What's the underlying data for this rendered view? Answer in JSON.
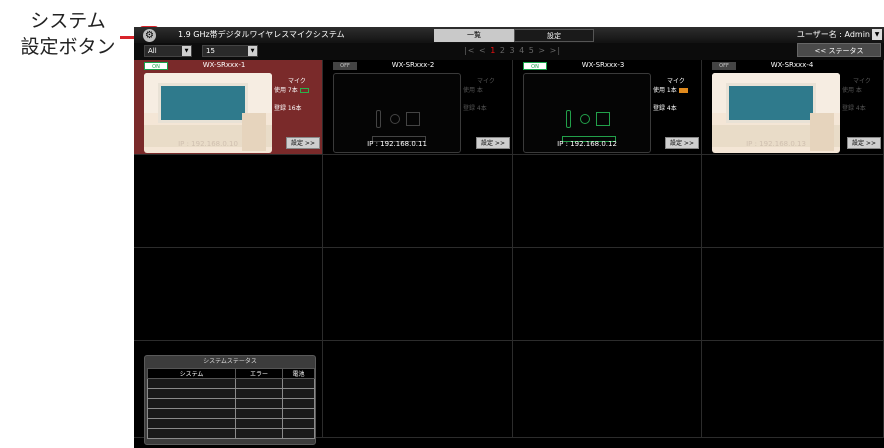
{
  "callout": {
    "line1": "システム",
    "line2": "設定ボタン"
  },
  "topbar": {
    "gear_glyph": "⚙",
    "app_title": "1.9 GHz帯デジタルワイヤレスマイクシステム",
    "tabs": [
      {
        "label": "一覧",
        "active": true
      },
      {
        "label": "設定",
        "active": false
      }
    ],
    "user_label": "ユーザー名 : Admin"
  },
  "filterbar": {
    "group_select": {
      "value": "All"
    },
    "count_select": {
      "value": "15"
    },
    "pager": {
      "first": "|<",
      "prev": "<",
      "pages": [
        "1",
        "2",
        "3",
        "4",
        "5"
      ],
      "current": "1",
      "next": ">",
      "last": ">|"
    },
    "status_button": "<< ステータス"
  },
  "cards": [
    {
      "state": "ON",
      "name": "WX-SRxxx-1",
      "view": "camera",
      "mic_label": "マイク",
      "in_use": "使用  7本",
      "registered": "登録  16本",
      "ip": "IP : 192.168.0.10",
      "settings": "設定 >>",
      "selected": true
    },
    {
      "state": "OFF",
      "name": "WX-SRxxx-2",
      "view": "device",
      "mic_label": "マイク",
      "in_use": "使用    本",
      "registered": "登録  4本",
      "ip": "IP : 192.168.0.11",
      "settings": "設定 >>",
      "selected": false
    },
    {
      "state": "ON",
      "name": "WX-SRxxx-3",
      "view": "device",
      "mic_label": "マイク",
      "in_use": "使用  1本",
      "registered": "登録  4本",
      "ip": "IP : 192.168.0.12",
      "settings": "設定 >>",
      "selected": false
    },
    {
      "state": "OFF",
      "name": "WX-SRxxx-4",
      "view": "camera",
      "mic_label": "マイク",
      "in_use": "使用    本",
      "registered": "登録  4本",
      "ip": "IP : 192.168.0.13",
      "settings": "設定 >>",
      "selected": false
    }
  ],
  "system_status": {
    "title": "システムステータス",
    "headers": [
      "システム",
      "エラー",
      "電池"
    ]
  },
  "colors": {
    "selected_card": "#7a2a2a",
    "on_green": "#17a34a",
    "pager_current": "#e11111",
    "callout_red": "#d8232a"
  }
}
